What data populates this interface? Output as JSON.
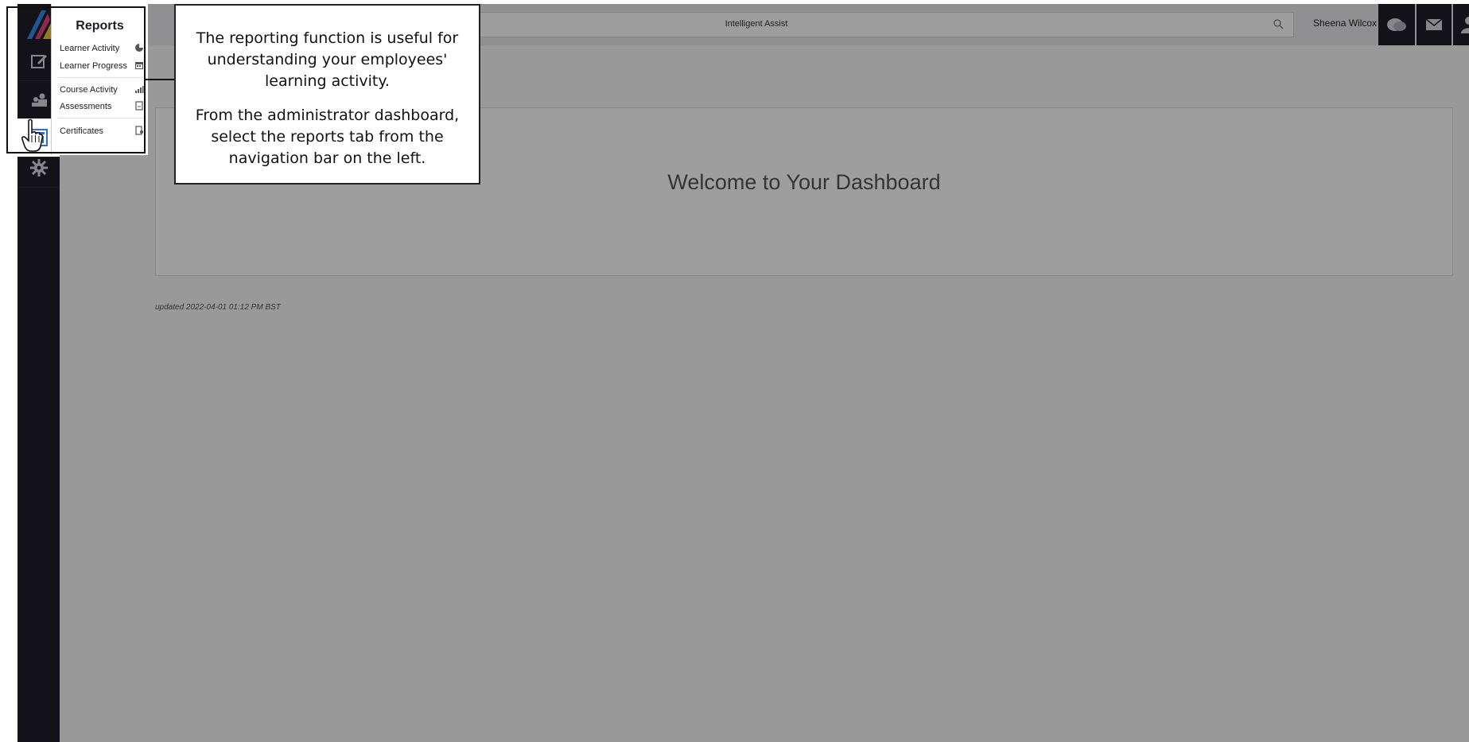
{
  "app": {
    "search": {
      "placeholder": "Intelligent Assist"
    },
    "user": {
      "name": "Sheena Wilcox"
    },
    "dashboard": {
      "welcome_title": "Welcome to Your Dashboard",
      "last_updated": "updated 2022-04-01 01:12 PM BST"
    },
    "nav_icons": [
      "logo",
      "edit-icon",
      "users-icon",
      "reports-icon",
      "settings-icon"
    ],
    "top_icons": [
      "help-icon",
      "mail-icon",
      "profile-icon"
    ]
  },
  "reports_menu": {
    "title": "Reports",
    "items": [
      {
        "label": "Learner Activity",
        "icon": "pie-chart-icon"
      },
      {
        "label": "Learner Progress",
        "icon": "calendar-icon"
      },
      {
        "label": "Course Activity",
        "icon": "bar-chart-icon"
      },
      {
        "label": "Assessments",
        "icon": "document-icon"
      },
      {
        "label": "Certificates",
        "icon": "certificate-icon"
      }
    ]
  },
  "callout": {
    "paragraph_1": "The reporting function is useful for understanding your employees' learning activity.",
    "paragraph_2": "From the administrator dashboard, select the reports tab from the navigation bar on the left."
  },
  "colors": {
    "nav_background": "#1e1e28",
    "overlay": "rgba(0,0,0,0.38)",
    "logo_gradient": [
      "#2f8ff0",
      "#f0c23a",
      "#e0457b"
    ]
  }
}
